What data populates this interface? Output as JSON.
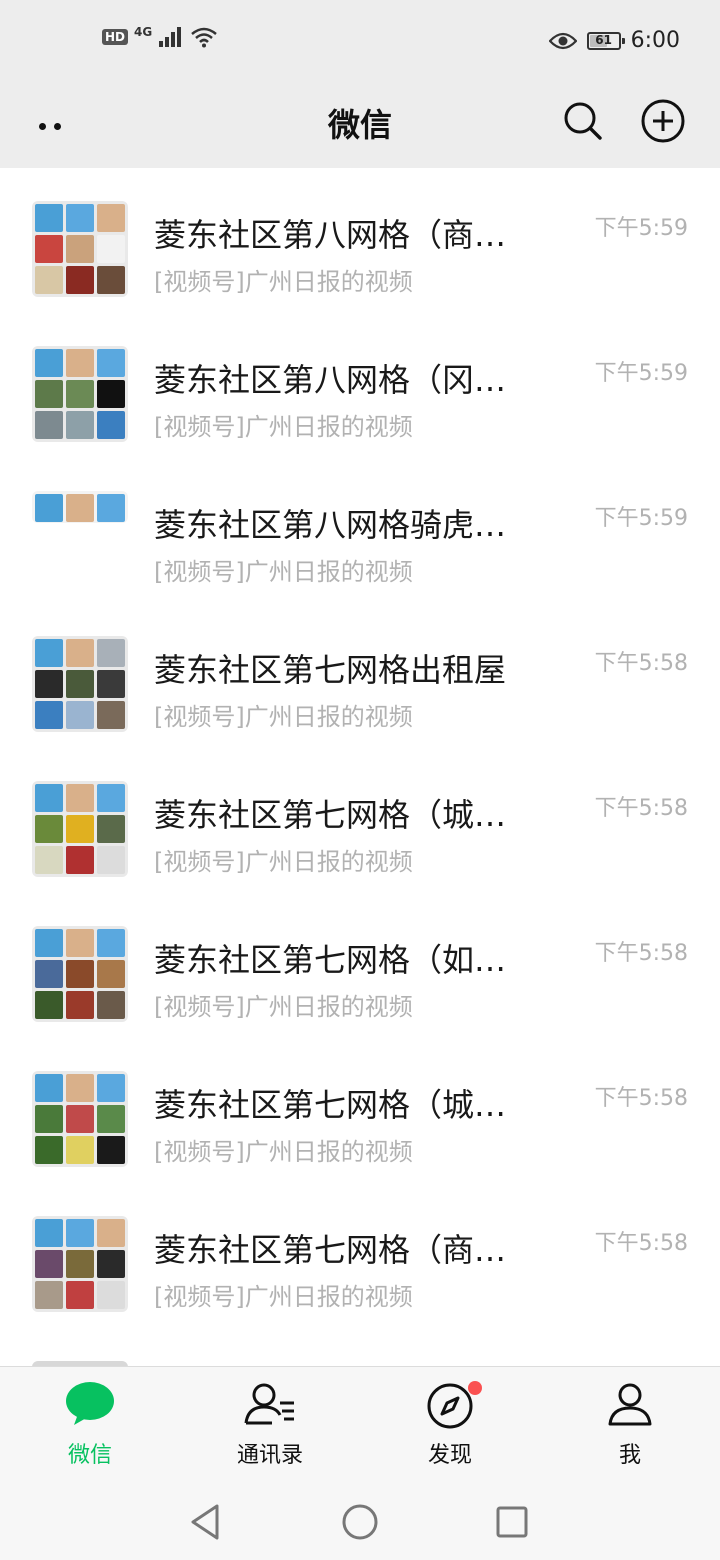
{
  "status_bar": {
    "hd": "HD",
    "network": "4G",
    "battery": "61",
    "battery_level": 0.61,
    "time": "6:00"
  },
  "header": {
    "title": "微信",
    "more_icon": "more-dots-icon",
    "search_icon": "search-icon",
    "add_icon": "plus-circle-icon"
  },
  "chats": [
    {
      "title": "菱东社区第八网格（商…",
      "subtitle": "[视频号]广州日报的视频",
      "time": "下午5:59"
    },
    {
      "title": "菱东社区第八网格（冈…",
      "subtitle": "[视频号]广州日报的视频",
      "time": "下午5:59"
    },
    {
      "title": "菱东社区第八网格骑虎…",
      "subtitle": "[视频号]广州日报的视频",
      "time": "下午5:59"
    },
    {
      "title": "菱东社区第七网格出租屋",
      "subtitle": "[视频号]广州日报的视频",
      "time": "下午5:58"
    },
    {
      "title": "菱东社区第七网格（城…",
      "subtitle": "[视频号]广州日报的视频",
      "time": "下午5:58"
    },
    {
      "title": "菱东社区第七网格（如…",
      "subtitle": "[视频号]广州日报的视频",
      "time": "下午5:58"
    },
    {
      "title": "菱东社区第七网格（城…",
      "subtitle": "[视频号]广州日报的视频",
      "time": "下午5:58"
    },
    {
      "title": "菱东社区第七网格（商…",
      "subtitle": "[视频号]广州日报的视频",
      "time": "下午5:58"
    }
  ],
  "tabbar": {
    "tabs": [
      {
        "label": "微信",
        "icon": "chat-bubble-icon",
        "active": true
      },
      {
        "label": "通讯录",
        "icon": "contacts-icon",
        "active": false
      },
      {
        "label": "发现",
        "icon": "compass-icon",
        "active": false
      },
      {
        "label": "我",
        "icon": "person-icon",
        "active": false
      }
    ]
  },
  "nav": {
    "back_icon": "back-triangle-icon",
    "home_icon": "home-circle-icon",
    "recents_icon": "recents-square-icon"
  },
  "colors": {
    "accent": "#07c160",
    "header_bg": "#ededed",
    "badge": "#fa5151"
  }
}
